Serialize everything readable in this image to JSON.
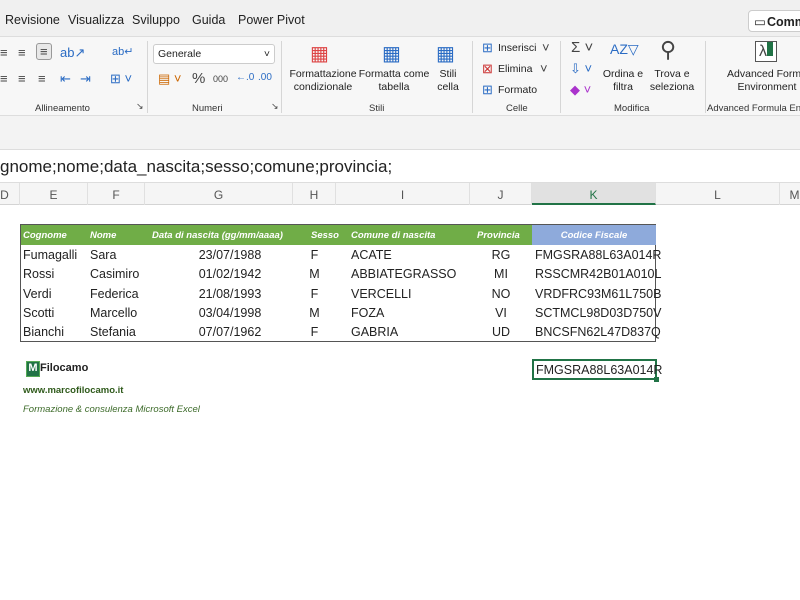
{
  "menu": {
    "tabs": [
      "Revisione",
      "Visualizza",
      "Sviluppo",
      "Guida",
      "Power Pivot"
    ],
    "comments": "Comm"
  },
  "ribbon": {
    "allineamento": "Allineamento",
    "numeri": {
      "label": "Numeri",
      "format": "Generale"
    },
    "stili": {
      "label": "Stili",
      "cond": "Formattazione\ncondizionale",
      "table": "Formatta come\ntabella",
      "cell": "Stili\ncella"
    },
    "celle": {
      "label": "Celle",
      "insert": "Inserisci",
      "delete": "Elimina",
      "format": "Formato"
    },
    "modifica": {
      "label": "Modifica",
      "sort": "Ordina e\nfiltra",
      "find": "Trova e\nseleziona"
    },
    "afe": {
      "label": "Advanced Formula Envir",
      "button": "Advanced Formu\nEnvironment"
    }
  },
  "formula_bar": "gnome;nome;data_nascita;sesso;comune;provincia;",
  "columns": [
    "D",
    "E",
    "F",
    "G",
    "H",
    "I",
    "J",
    "K",
    "L",
    "M"
  ],
  "selected_column": "K",
  "table": {
    "headers": [
      "Cognome",
      "Nome",
      "Data di nascita (gg/mm/aaaa)",
      "Sesso",
      "Comune di nascita",
      "Provincia",
      "Codice Fiscale"
    ],
    "rows": [
      [
        "Fumagalli",
        "Sara",
        "23/07/1988",
        "F",
        "ACATE",
        "RG",
        "FMGSRA88L63A014R"
      ],
      [
        "Rossi",
        "Casimiro",
        "01/02/1942",
        "M",
        "ABBIATEGRASSO",
        "MI",
        "RSSCMR42B01A010L"
      ],
      [
        "Verdi",
        "Federica",
        "21/08/1993",
        "F",
        "VERCELLI",
        "NO",
        "VRDFRC93M61L750B"
      ],
      [
        "Scotti",
        "Marcello",
        "03/04/1998",
        "M",
        "FOZA",
        "VI",
        "SCTMCL98D03D750V"
      ],
      [
        "Bianchi",
        "Stefania",
        "07/07/1962",
        "F",
        "GABRIA",
        "UD",
        "BNCSFN62L47D837Q"
      ]
    ]
  },
  "selected_cell_value": "FMGSRA88L63A014R",
  "branding": {
    "logo": "MFilocamo",
    "website": "www.marcofilocamo.it",
    "tagline": "Formazione & consulenza Microsoft Excel"
  },
  "colors": {
    "header_green": "#70ad47",
    "header_blue": "#8eaadb",
    "excel_green": "#217346"
  }
}
